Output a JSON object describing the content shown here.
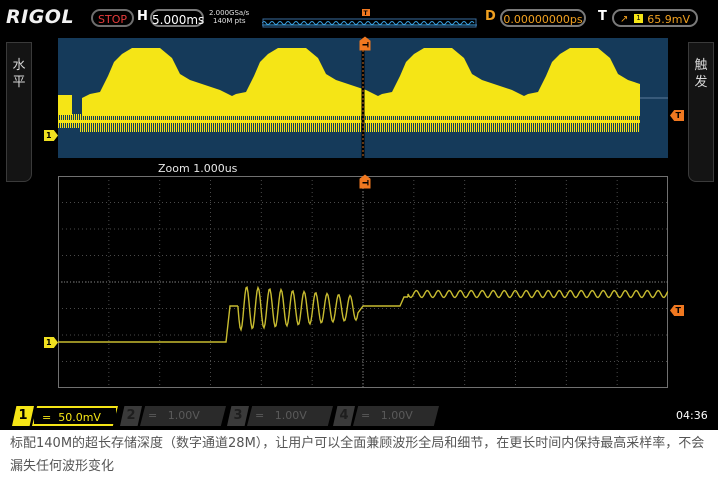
{
  "topbar": {
    "brand": "RIGOL",
    "run_state": "STOP",
    "h_label": "H",
    "timebase": "5.000ms",
    "sample_rate": "2.000GSa/s",
    "memory_depth": "140M pts",
    "d_label": "D",
    "delay": "0.00000000ps",
    "t_label": "T",
    "trigger_level": "65.9mV"
  },
  "side_tabs": {
    "left": "水平",
    "right": "触发"
  },
  "markers": {
    "channel": "1",
    "trigger": "T"
  },
  "zoom": {
    "label": "Zoom 1.000us"
  },
  "channels": [
    {
      "num": "1",
      "coupling": "=",
      "scale": "50.0mV",
      "active": true,
      "color": "#f5e516"
    },
    {
      "num": "2",
      "coupling": "=",
      "scale": "1.00V",
      "active": false,
      "color": "#3a3a3a"
    },
    {
      "num": "3",
      "coupling": "=",
      "scale": "1.00V",
      "active": false,
      "color": "#3a3a3a"
    },
    {
      "num": "4",
      "coupling": "=",
      "scale": "1.00V",
      "active": false,
      "color": "#3a3a3a"
    }
  ],
  "clock": "04:36",
  "caption": "标配140M的超长存储深度（数字通道28M），让用户可以全面兼顾波形全局和细节，在更长时间内保持最高采样率，不会漏失任何波形变化",
  "colors": {
    "trace": "#f5e516",
    "overview_bg": "#153a5a",
    "stop": "#e53b3b",
    "trigger": "#f0a020",
    "grid": "#5a5a5a"
  }
}
